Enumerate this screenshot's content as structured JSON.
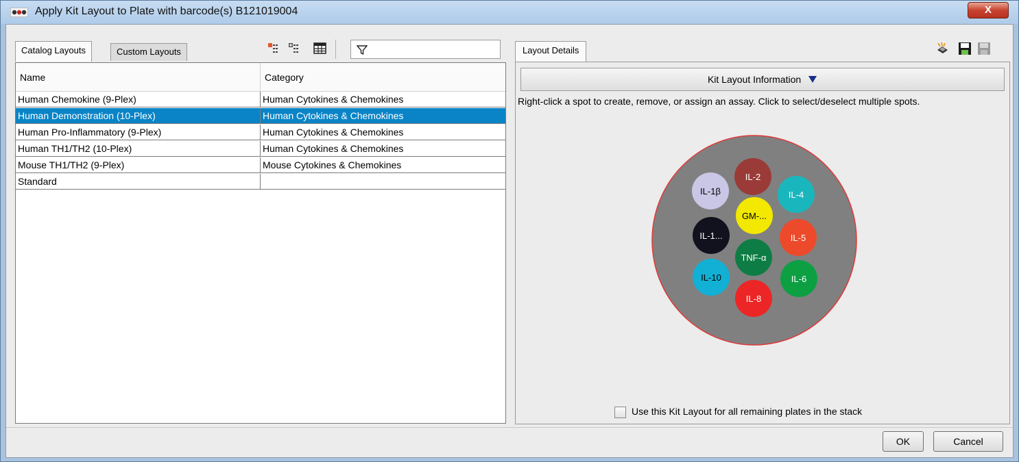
{
  "window": {
    "title": "Apply Kit Layout to Plate with barcode(s) B121019004",
    "close_label": "X"
  },
  "left": {
    "tabs": [
      {
        "label": "Catalog Layouts",
        "active": true
      },
      {
        "label": "Custom Layouts",
        "active": false
      }
    ],
    "toolbar_icons": [
      "add-layout-icon",
      "import-layout-icon",
      "table-view-icon",
      "filter-icon"
    ],
    "filter": {
      "value": ""
    },
    "table": {
      "columns": [
        "Name",
        "Category"
      ],
      "rows": [
        {
          "name": "Human Chemokine (9-Plex)",
          "category": "Human Cytokines & Chemokines",
          "selected": false
        },
        {
          "name": "Human Demonstration (10-Plex)",
          "category": "Human Cytokines & Chemokines",
          "selected": true
        },
        {
          "name": "Human Pro-Inflammatory (9-Plex)",
          "category": "Human Cytokines & Chemokines",
          "selected": false
        },
        {
          "name": "Human TH1/TH2 (10-Plex)",
          "category": "Human Cytokines & Chemokines",
          "selected": false
        },
        {
          "name": "Mouse TH1/TH2 (9-Plex)",
          "category": "Mouse Cytokines & Chemokines",
          "selected": false
        },
        {
          "name": "Standard",
          "category": "",
          "selected": false
        }
      ]
    }
  },
  "right": {
    "tab_label": "Layout Details",
    "toolbar_icons": [
      "clear-spots-icon",
      "save-icon",
      "save-as-icon"
    ],
    "kit_header": "Kit Layout Information",
    "instructions": "Right-click a spot to create, remove, or assign an assay. Click to select/deselect multiple spots.",
    "spots": [
      {
        "label": "IL-2",
        "color": "#9b3b38",
        "text_color": "#ffffff"
      },
      {
        "label": "IL-1β",
        "color": "#c9c6e6",
        "text_color": "#000000"
      },
      {
        "label": "IL-4",
        "color": "#1ab6bd",
        "text_color": "#ffffff"
      },
      {
        "label": "GM-...",
        "color": "#f2e800",
        "text_color": "#000000"
      },
      {
        "label": "IL-1...",
        "color": "#12121e",
        "text_color": "#ffffff"
      },
      {
        "label": "IL-5",
        "color": "#ec4a2a",
        "text_color": "#ffffff"
      },
      {
        "label": "TNF-α",
        "color": "#0e7d45",
        "text_color": "#ffffff"
      },
      {
        "label": "IL-10",
        "color": "#12b0d4",
        "text_color": "#000000"
      },
      {
        "label": "IL-6",
        "color": "#0ca043",
        "text_color": "#ffffff"
      },
      {
        "label": "IL-8",
        "color": "#ec2626",
        "text_color": "#ffffff"
      }
    ],
    "apply_all": {
      "label": "Use this Kit Layout for all remaining plates in the stack",
      "checked": false
    }
  },
  "buttons": {
    "ok": "OK",
    "cancel": "Cancel"
  }
}
